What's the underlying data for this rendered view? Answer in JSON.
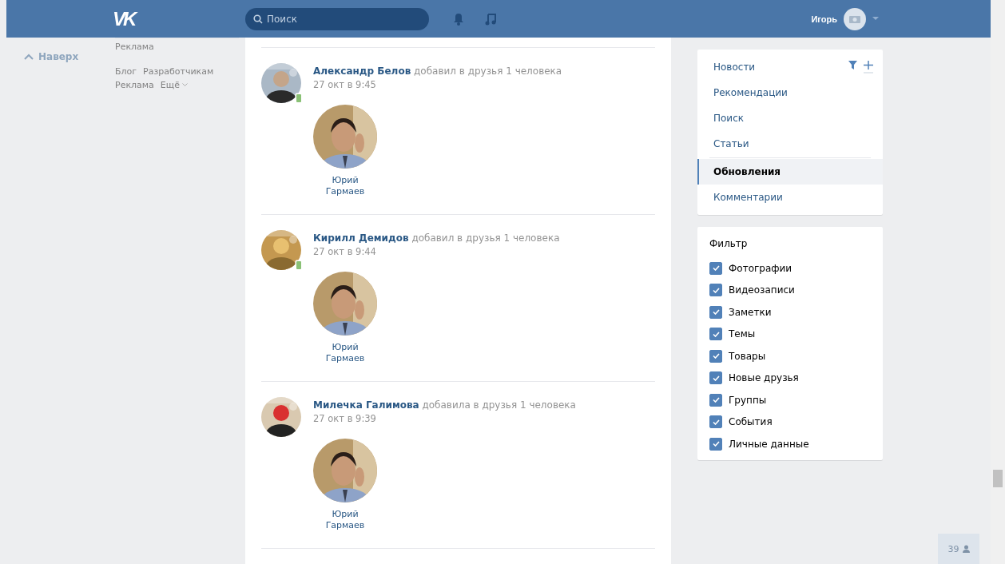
{
  "header": {
    "logo": "VK",
    "search": {
      "placeholder": "Поиск"
    },
    "user": {
      "name": "Игорь"
    }
  },
  "left_nav": {
    "back_to_top": "Наверх",
    "ad_label": "Реклама",
    "links": [
      "Блог",
      "Разработчикам",
      "Реклама",
      "Ещё"
    ]
  },
  "feed": [
    {
      "author": "Александр Белов",
      "action": "добавил в друзья 1 человека",
      "time": "27 окт в 9:45",
      "online_mobile": true,
      "friends": [
        {
          "name": "Юрий Гармаев"
        }
      ]
    },
    {
      "author": "Кирилл Демидов",
      "action": "добавил в друзья 1 человека",
      "time": "27 окт в 9:44",
      "online_mobile": true,
      "friends": [
        {
          "name": "Юрий Гармаев"
        }
      ]
    },
    {
      "author": "Милечка Галимова",
      "action": "добавила в друзья 1 человека",
      "time": "27 окт в 9:39",
      "online_mobile": false,
      "friends": [
        {
          "name": "Юрий Гармаев"
        }
      ]
    }
  ],
  "sections_menu": {
    "items": [
      {
        "label": "Новости",
        "selected": false,
        "divider_above": false
      },
      {
        "label": "Рекомендации",
        "selected": false,
        "divider_above": false
      },
      {
        "label": "Поиск",
        "selected": false,
        "divider_above": false
      },
      {
        "label": "Статьи",
        "selected": false,
        "divider_above": false
      },
      {
        "label": "Обновления",
        "selected": true,
        "divider_above": true
      },
      {
        "label": "Комментарии",
        "selected": false,
        "divider_above": false
      }
    ]
  },
  "filter": {
    "title": "Фильтр",
    "options": [
      {
        "label": "Фотографии",
        "checked": true
      },
      {
        "label": "Видеозаписи",
        "checked": true
      },
      {
        "label": "Заметки",
        "checked": true
      },
      {
        "label": "Темы",
        "checked": true
      },
      {
        "label": "Товары",
        "checked": true
      },
      {
        "label": "Новые друзья",
        "checked": true
      },
      {
        "label": "Группы",
        "checked": true
      },
      {
        "label": "События",
        "checked": true
      },
      {
        "label": "Личные данные",
        "checked": true
      }
    ]
  },
  "online_counter": "39"
}
